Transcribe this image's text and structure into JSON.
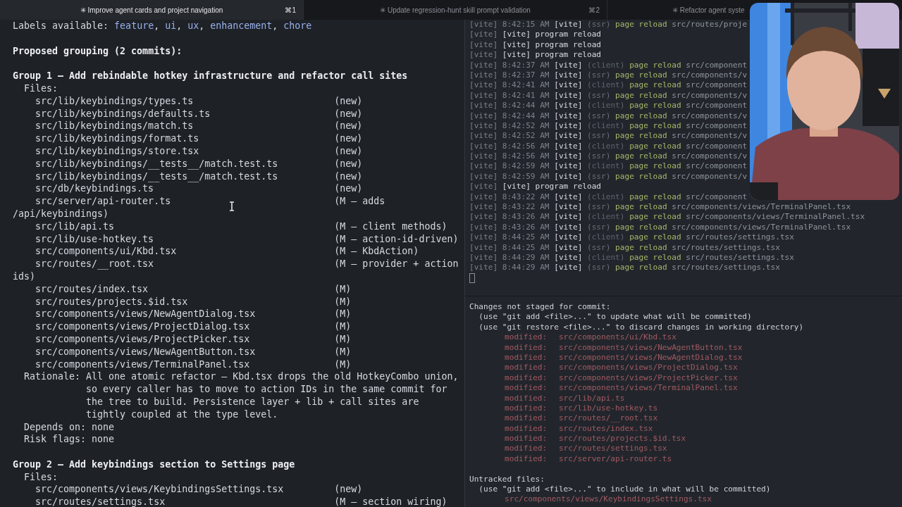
{
  "tabs": [
    {
      "icon": "✳",
      "title": "Improve agent cards and project navigation",
      "shortcut": "⌘1",
      "selected": true
    },
    {
      "icon": "✳",
      "title": "Update regression-hunt skill prompt validation",
      "shortcut": "⌘2",
      "selected": false
    },
    {
      "icon": "✳",
      "title": "Refactor agent syste",
      "selected": false
    }
  ],
  "left_pane": {
    "lines": [
      {
        "kind": "labels",
        "label": "Labels available:",
        "separator": ", ",
        "items": [
          "feature",
          "ui",
          "ux",
          "enhancement",
          "chore"
        ]
      },
      {
        "kind": "blank"
      },
      {
        "kind": "heading",
        "text": "Proposed grouping (2 commits):"
      },
      {
        "kind": "blank"
      },
      {
        "kind": "heading",
        "text": "Group 1 — Add rebindable hotkey infrastructure and refactor call sites"
      },
      {
        "kind": "text",
        "text": "  Files:"
      },
      {
        "kind": "file",
        "path": "src/lib/keybindings/types.ts",
        "note": "(new)"
      },
      {
        "kind": "file",
        "path": "src/lib/keybindings/defaults.ts",
        "note": "(new)"
      },
      {
        "kind": "file",
        "path": "src/lib/keybindings/match.ts",
        "note": "(new)"
      },
      {
        "kind": "file",
        "path": "src/lib/keybindings/format.ts",
        "note": "(new)"
      },
      {
        "kind": "file",
        "path": "src/lib/keybindings/store.tsx",
        "note": "(new)"
      },
      {
        "kind": "file",
        "path": "src/lib/keybindings/__tests__/match.test.ts",
        "note": "(new)"
      },
      {
        "kind": "file",
        "path": "src/lib/keybindings/__tests__/match.test.ts",
        "note": "(new)"
      },
      {
        "kind": "file",
        "path": "src/db/keybindings.ts",
        "note": "(new)"
      },
      {
        "kind": "file",
        "path": "src/server/api-router.ts",
        "note": "(M — adds"
      },
      {
        "kind": "text",
        "text": "/api/keybindings)"
      },
      {
        "kind": "file",
        "path": "src/lib/api.ts",
        "note": "(M — client methods)"
      },
      {
        "kind": "file",
        "path": "src/lib/use-hotkey.ts",
        "note": "(M — action-id-driven)"
      },
      {
        "kind": "file",
        "path": "src/components/ui/Kbd.tsx",
        "note": "(M — KbdAction)"
      },
      {
        "kind": "file",
        "path": "src/routes/__root.tsx",
        "note": "(M — provider + action"
      },
      {
        "kind": "text",
        "text": "ids)"
      },
      {
        "kind": "file",
        "path": "src/routes/index.tsx",
        "note": "(M)"
      },
      {
        "kind": "file",
        "path": "src/routes/projects.$id.tsx",
        "note": "(M)"
      },
      {
        "kind": "file",
        "path": "src/components/views/NewAgentDialog.tsx",
        "note": "(M)"
      },
      {
        "kind": "file",
        "path": "src/components/views/ProjectDialog.tsx",
        "note": "(M)"
      },
      {
        "kind": "file",
        "path": "src/components/views/ProjectPicker.tsx",
        "note": "(M)"
      },
      {
        "kind": "file",
        "path": "src/components/views/NewAgentButton.tsx",
        "note": "(M)"
      },
      {
        "kind": "file",
        "path": "src/components/views/TerminalPanel.tsx",
        "note": "(M)"
      },
      {
        "kind": "text",
        "text": "  Rationale: All one atomic refactor — Kbd.tsx drops the old HotkeyCombo union,"
      },
      {
        "kind": "text",
        "text": "             so every caller has to move to action IDs in the same commit for"
      },
      {
        "kind": "text",
        "text": "             the tree to build. Persistence layer + lib + call sites are"
      },
      {
        "kind": "text",
        "text": "             tightly coupled at the type level."
      },
      {
        "kind": "text",
        "text": "  Depends on: none"
      },
      {
        "kind": "text",
        "text": "  Risk flags: none"
      },
      {
        "kind": "blank"
      },
      {
        "kind": "heading",
        "text": "Group 2 — Add keybindings section to Settings page"
      },
      {
        "kind": "text",
        "text": "  Files:"
      },
      {
        "kind": "file",
        "path": "src/components/views/KeybindingsSettings.tsx",
        "note": "(new)"
      },
      {
        "kind": "file",
        "path": "src/routes/settings.tsx",
        "note": "(M — section wiring)"
      }
    ]
  },
  "log_pane": {
    "lines": [
      {
        "kind": "reload",
        "prefix": "[vite]",
        "time": "8:42:15 AM",
        "source": "[vite]",
        "tag": "(ssr)",
        "action": "page reload",
        "path": "src/routes/proje"
      },
      {
        "kind": "program",
        "prefix": "[vite]",
        "message": "[vite] program reload"
      },
      {
        "kind": "program",
        "prefix": "[vite]",
        "message": "[vite] program reload"
      },
      {
        "kind": "program",
        "prefix": "[vite]",
        "message": "[vite] program reload"
      },
      {
        "kind": "reload",
        "prefix": "[vite]",
        "time": "8:42:37 AM",
        "source": "[vite]",
        "tag": "(client)",
        "action": "page reload",
        "path": "src/component"
      },
      {
        "kind": "reload",
        "prefix": "[vite]",
        "time": "8:42:37 AM",
        "source": "[vite]",
        "tag": "(ssr)",
        "action": "page reload",
        "path": "src/components/v"
      },
      {
        "kind": "reload",
        "prefix": "[vite]",
        "time": "8:42:41 AM",
        "source": "[vite]",
        "tag": "(client)",
        "action": "page reload",
        "path": "src/component"
      },
      {
        "kind": "reload",
        "prefix": "[vite]",
        "time": "8:42:41 AM",
        "source": "[vite]",
        "tag": "(ssr)",
        "action": "page reload",
        "path": "src/components/v"
      },
      {
        "kind": "reload",
        "prefix": "[vite]",
        "time": "8:42:44 AM",
        "source": "[vite]",
        "tag": "(client)",
        "action": "page reload",
        "path": "src/component"
      },
      {
        "kind": "reload",
        "prefix": "[vite]",
        "time": "8:42:44 AM",
        "source": "[vite]",
        "tag": "(ssr)",
        "action": "page reload",
        "path": "src/components/v"
      },
      {
        "kind": "reload",
        "prefix": "[vite]",
        "time": "8:42:52 AM",
        "source": "[vite]",
        "tag": "(client)",
        "action": "page reload",
        "path": "src/component"
      },
      {
        "kind": "reload",
        "prefix": "[vite]",
        "time": "8:42:52 AM",
        "source": "[vite]",
        "tag": "(ssr)",
        "action": "page reload",
        "path": "src/components/v"
      },
      {
        "kind": "reload",
        "prefix": "[vite]",
        "time": "8:42:56 AM",
        "source": "[vite]",
        "tag": "(client)",
        "action": "page reload",
        "path": "src/component"
      },
      {
        "kind": "reload",
        "prefix": "[vite]",
        "time": "8:42:56 AM",
        "source": "[vite]",
        "tag": "(ssr)",
        "action": "page reload",
        "path": "src/components/v"
      },
      {
        "kind": "reload",
        "prefix": "[vite]",
        "time": "8:42:59 AM",
        "source": "[vite]",
        "tag": "(client)",
        "action": "page reload",
        "path": "src/component"
      },
      {
        "kind": "reload",
        "prefix": "[vite]",
        "time": "8:42:59 AM",
        "source": "[vite]",
        "tag": "(ssr)",
        "action": "page reload",
        "path": "src/components/v"
      },
      {
        "kind": "program",
        "prefix": "[vite]",
        "message": "[vite] program reload"
      },
      {
        "kind": "reload",
        "prefix": "[vite]",
        "time": "8:43:22 AM",
        "source": "[vite]",
        "tag": "(client)",
        "action": "page reload",
        "path": "src/component"
      },
      {
        "kind": "reload",
        "prefix": "[vite]",
        "time": "8:43:22 AM",
        "source": "[vite]",
        "tag": "(ssr)",
        "action": "page reload",
        "path": "src/components/views/TerminalPanel.tsx"
      },
      {
        "kind": "reload",
        "prefix": "[vite]",
        "time": "8:43:26 AM",
        "source": "[vite]",
        "tag": "(client)",
        "action": "page reload",
        "path": "src/components/views/TerminalPanel.tsx"
      },
      {
        "kind": "reload",
        "prefix": "[vite]",
        "time": "8:43:26 AM",
        "source": "[vite]",
        "tag": "(ssr)",
        "action": "page reload",
        "path": "src/components/views/TerminalPanel.tsx"
      },
      {
        "kind": "reload",
        "prefix": "[vite]",
        "time": "8:44:25 AM",
        "source": "[vite]",
        "tag": "(client)",
        "action": "page reload",
        "path": "src/routes/settings.tsx"
      },
      {
        "kind": "reload",
        "prefix": "[vite]",
        "time": "8:44:25 AM",
        "source": "[vite]",
        "tag": "(ssr)",
        "action": "page reload",
        "path": "src/routes/settings.tsx"
      },
      {
        "kind": "reload",
        "prefix": "[vite]",
        "time": "8:44:29 AM",
        "source": "[vite]",
        "tag": "(client)",
        "action": "page reload",
        "path": "src/routes/settings.tsx"
      },
      {
        "kind": "reload",
        "prefix": "[vite]",
        "time": "8:44:29 AM",
        "source": "[vite]",
        "tag": "(ssr)",
        "action": "page reload",
        "path": "src/routes/settings.tsx"
      },
      {
        "kind": "cursor"
      }
    ]
  },
  "git_pane": {
    "lines": [
      {
        "kind": "header",
        "text": "Changes not staged for commit:"
      },
      {
        "kind": "hint",
        "text": "(use \"git add <file>...\" to update what will be committed)"
      },
      {
        "kind": "hint",
        "text": "(use \"git restore <file>...\" to discard changes in working directory)"
      },
      {
        "kind": "modified",
        "label": "modified:",
        "path": "src/components/ui/Kbd.tsx"
      },
      {
        "kind": "modified",
        "label": "modified:",
        "path": "src/components/views/NewAgentButton.tsx"
      },
      {
        "kind": "modified",
        "label": "modified:",
        "path": "src/components/views/NewAgentDialog.tsx"
      },
      {
        "kind": "modified",
        "label": "modified:",
        "path": "src/components/views/ProjectDialog.tsx"
      },
      {
        "kind": "modified",
        "label": "modified:",
        "path": "src/components/views/ProjectPicker.tsx"
      },
      {
        "kind": "modified",
        "label": "modified:",
        "path": "src/components/views/TerminalPanel.tsx"
      },
      {
        "kind": "modified",
        "label": "modified:",
        "path": "src/lib/api.ts"
      },
      {
        "kind": "modified",
        "label": "modified:",
        "path": "src/lib/use-hotkey.ts"
      },
      {
        "kind": "modified",
        "label": "modified:",
        "path": "src/routes/__root.tsx"
      },
      {
        "kind": "modified",
        "label": "modified:",
        "path": "src/routes/index.tsx"
      },
      {
        "kind": "modified",
        "label": "modified:",
        "path": "src/routes/projects.$id.tsx"
      },
      {
        "kind": "modified",
        "label": "modified:",
        "path": "src/routes/settings.tsx"
      },
      {
        "kind": "modified",
        "label": "modified:",
        "path": "src/server/api-router.ts"
      },
      {
        "kind": "blank"
      },
      {
        "kind": "header",
        "text": "Untracked files:"
      },
      {
        "kind": "hint",
        "text": "(use \"git add <file>...\" to include in what will be committed)"
      },
      {
        "kind": "untracked",
        "path": "src/components/views/KeybindingsSettings.tsx"
      }
    ]
  }
}
